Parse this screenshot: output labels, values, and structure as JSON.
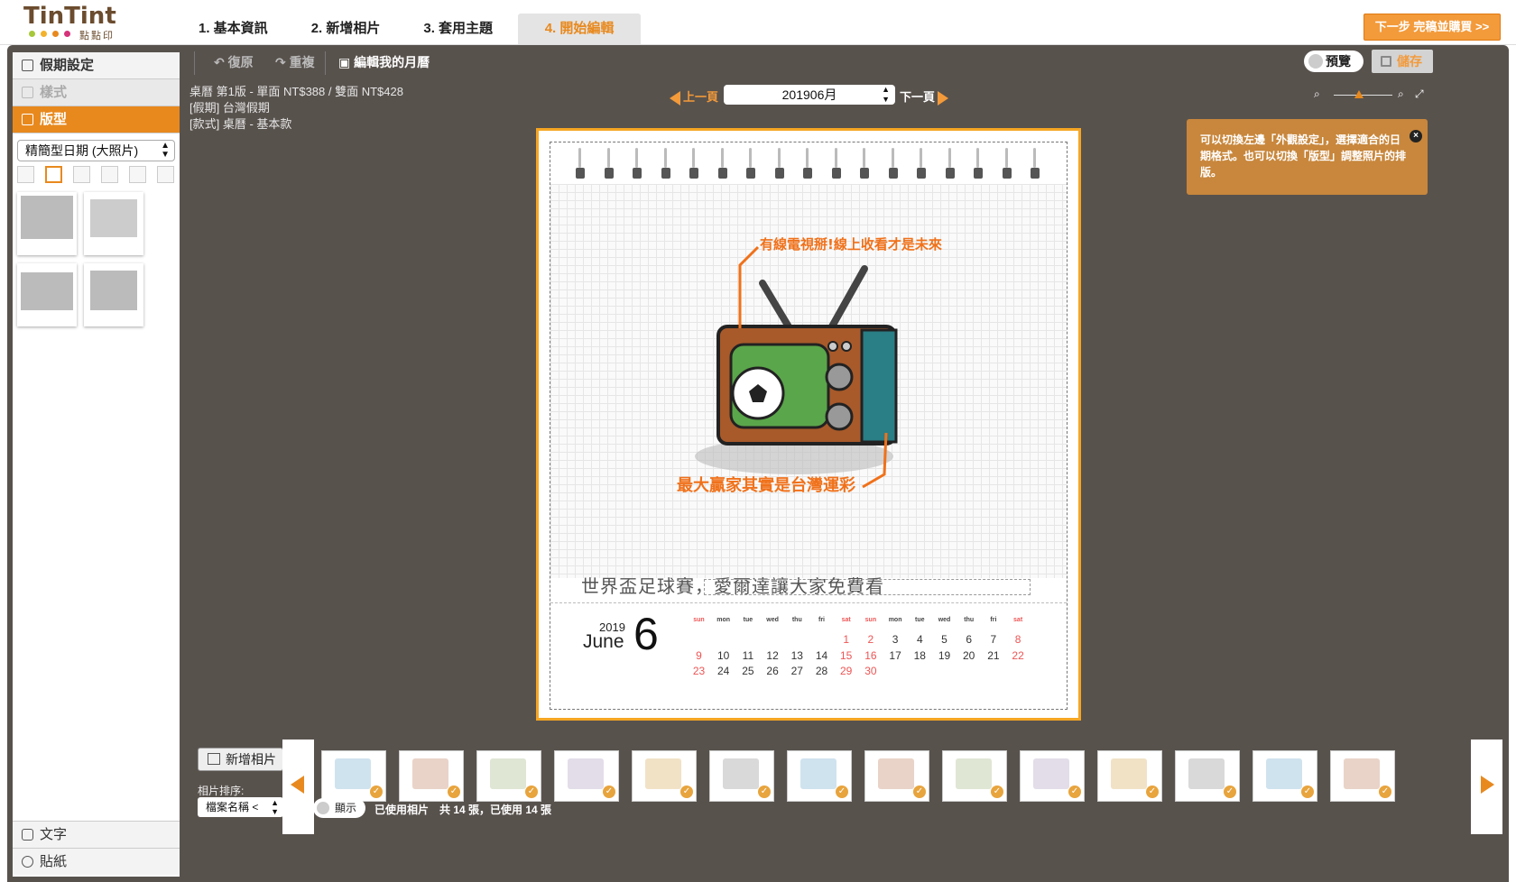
{
  "logo": {
    "name": "TinTint",
    "sub": "點點印"
  },
  "steps": [
    {
      "label": "1. 基本資訊"
    },
    {
      "label": "2. 新增相片"
    },
    {
      "label": "3. 套用主題"
    },
    {
      "label": "4. 開始編輯"
    }
  ],
  "next_button": "下一步 完稿並購買 >>",
  "sidebar": {
    "items": [
      {
        "label": "假期設定"
      },
      {
        "label": "樣式"
      },
      {
        "label": "版型"
      }
    ],
    "layout_select": "精簡型日期 (大照片)",
    "bottom": [
      {
        "label": "文字"
      },
      {
        "label": "貼紙"
      }
    ]
  },
  "toolbar": {
    "undo": "復原",
    "redo": "重複",
    "edit_title": "編輯我的月曆",
    "preview": "預覽",
    "save": "儲存"
  },
  "info": {
    "line1": "桌曆 第1版 - 單面 NT$388 / 雙面 NT$428",
    "line2": "[假期] 台灣假期",
    "line3": "[款式] 桌曆 - 基本款"
  },
  "pager": {
    "prev": "上一頁",
    "current": "201906月",
    "next": "下一頁"
  },
  "tooltip": {
    "text": "可以切換左邊「外觀設定」，選擇適合的日期格式。也可以切換「版型」調整照片的排版。",
    "close": "×"
  },
  "calendar": {
    "caption": "世界盃足球賽，愛爾達讓大家免費看",
    "year": "2019",
    "month_name": "June",
    "month_number": "6",
    "weekday_headers": [
      "sun",
      "mon",
      "tue",
      "wed",
      "thu",
      "fri",
      "sat",
      "sun",
      "mon",
      "tue",
      "wed",
      "thu",
      "fri",
      "sat"
    ],
    "rows": [
      [
        "",
        "",
        "",
        "",
        "",
        "",
        "1",
        "2",
        "3",
        "4",
        "5",
        "6",
        "7",
        "8"
      ],
      [
        "9",
        "10",
        "11",
        "12",
        "13",
        "14",
        "15",
        "16",
        "17",
        "18",
        "19",
        "20",
        "21",
        "22"
      ],
      [
        "23",
        "24",
        "25",
        "26",
        "27",
        "28",
        "29",
        "30",
        "",
        "",
        "",
        "",
        "",
        ""
      ]
    ]
  },
  "filmstrip": {
    "add_photo": "新增相片",
    "sort_label": "相片排序:",
    "sort_value": "檔案名稱 <",
    "show_toggle": "顯示",
    "footer": "已使用相片　共 14 張，已使用 14 張",
    "photo_count": 14
  },
  "colors": {
    "accent": "#e8891e",
    "frame": "#58524d",
    "page_border": "#f5a623",
    "weekend": "#e55555"
  }
}
